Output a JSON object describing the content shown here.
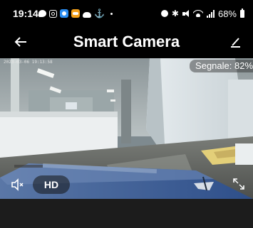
{
  "status_bar": {
    "time": "19:14",
    "battery": "68%",
    "left_icons": [
      "chat-icon",
      "instagram-icon",
      "blue-app-icon",
      "orange-app-icon",
      "cloud-icon",
      "anchor-icon",
      "dot-icon"
    ],
    "right_icons": [
      "alarm-icon",
      "bluetooth-icon",
      "mute-status-icon",
      "wifi-icon",
      "signal-icon",
      "battery-icon"
    ]
  },
  "header": {
    "title": "Smart Camera",
    "back_icon": "arrow-left-icon",
    "edit_icon": "pencil-icon"
  },
  "video": {
    "timestamp": "2023-03-06 19:13:58",
    "signal_label": "Segnale: 82%",
    "quality_label": "HD",
    "mute_icon": "speaker-muted-icon",
    "fullscreen_icon": "fullscreen-icon"
  },
  "colors": {
    "background": "#1b1b1b",
    "bars": "#000000",
    "text": "#ffffff"
  }
}
